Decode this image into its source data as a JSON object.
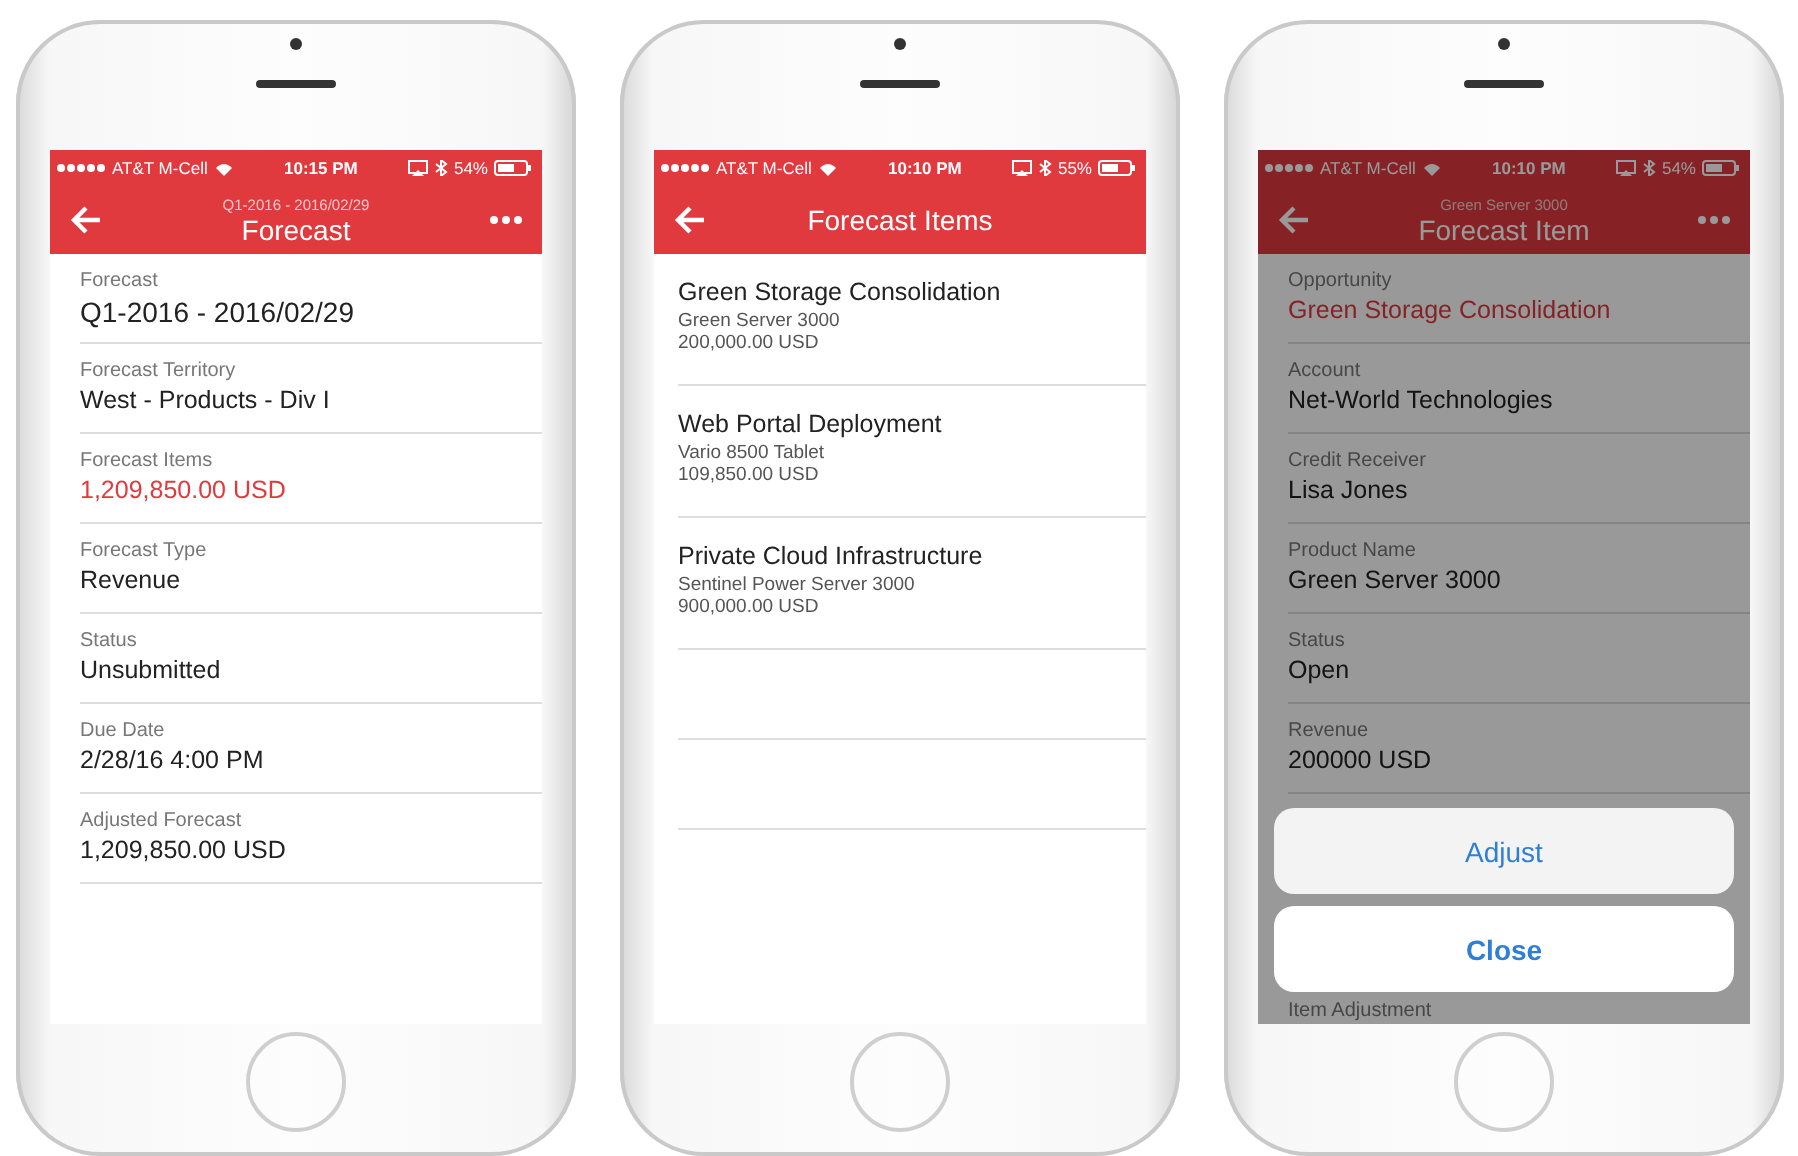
{
  "phones": [
    {
      "kind": "detail",
      "dimmed": false,
      "status_bar": {
        "carrier": "AT&T M-Cell",
        "time": "10:15 PM",
        "battery": "54%"
      },
      "nav": {
        "subtitle": "Q1-2016 - 2016/02/29",
        "title": "Forecast",
        "more": true
      },
      "fields": [
        {
          "label": "Forecast",
          "value": "Q1-2016 - 2016/02/29",
          "kind": "large"
        },
        {
          "label": "Forecast Territory",
          "value": "West - Products - Div I",
          "kind": "text"
        },
        {
          "label": "Forecast Items",
          "value": "1,209,850.00 USD",
          "kind": "link"
        },
        {
          "label": "Forecast Type",
          "value": "Revenue",
          "kind": "text"
        },
        {
          "label": "Status",
          "value": "Unsubmitted",
          "kind": "text"
        },
        {
          "label": "Due Date",
          "value": "2/28/16 4:00 PM",
          "kind": "text"
        },
        {
          "label": "Adjusted Forecast",
          "value": "1,209,850.00 USD",
          "kind": "text"
        }
      ]
    },
    {
      "kind": "list",
      "dimmed": false,
      "status_bar": {
        "carrier": "AT&T M-Cell",
        "time": "10:10 PM",
        "battery": "55%"
      },
      "nav": {
        "title": "Forecast Items",
        "more": false
      },
      "items": [
        {
          "title": "Green Storage Consolidation",
          "product": "Green Server 3000",
          "amount": "200,000.00 USD"
        },
        {
          "title": "Web Portal Deployment",
          "product": "Vario 8500 Tablet",
          "amount": "109,850.00 USD"
        },
        {
          "title": "Private Cloud Infrastructure",
          "product": "Sentinel Power Server 3000",
          "amount": "900,000.00 USD"
        }
      ]
    },
    {
      "kind": "detail",
      "dimmed": true,
      "status_bar": {
        "carrier": "AT&T M-Cell",
        "time": "10:10 PM",
        "battery": "54%"
      },
      "nav": {
        "subtitle": "Green Server 3000",
        "title": "Forecast Item",
        "more": true
      },
      "fields": [
        {
          "label": "Opportunity",
          "value": "Green Storage Consolidation",
          "kind": "link"
        },
        {
          "label": "Account",
          "value": "Net-World Technologies",
          "kind": "text"
        },
        {
          "label": "Credit Receiver",
          "value": "Lisa Jones",
          "kind": "text"
        },
        {
          "label": "Product Name",
          "value": "Green Server 3000",
          "kind": "text"
        },
        {
          "label": "Status",
          "value": "Open",
          "kind": "text"
        },
        {
          "label": "Revenue",
          "value": "200000 USD",
          "kind": "text"
        },
        {
          "label": "Item Adjustment",
          "kind": "bottom"
        }
      ],
      "action_sheet": [
        {
          "label": "Adjust",
          "kind": "action"
        },
        {
          "label": "Close",
          "kind": "cancel"
        }
      ]
    }
  ]
}
